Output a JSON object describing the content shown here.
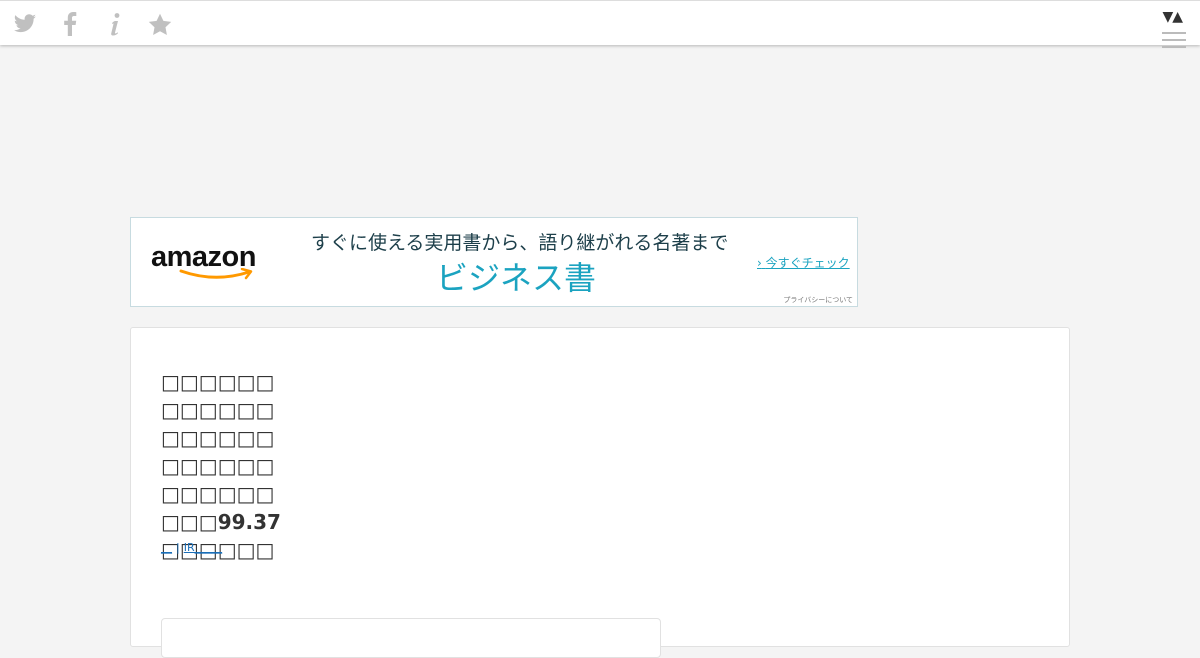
{
  "toolbar": {
    "icons": [
      "twitter-icon",
      "facebook-icon",
      "info-icon",
      "star-icon"
    ],
    "sort_toggle": "▼▲",
    "icon_color": "#c0c0c0"
  },
  "ad": {
    "brand": "amazon",
    "tagline": "すぐに使える実用書から、語り継がれる名著まで",
    "headline": "ビジネス書",
    "cta": "今すぐチェック",
    "privacy": "プライバシーについて",
    "accent_color": "#1ba3c0",
    "smile_color": "#ff9900"
  },
  "article": {
    "title": "□□□□□□□□□□□□□□□□□□□□□□□□□□□□□□□□□99.37□□□□□□",
    "link_primary": "__",
    "link_secondary": "IR_____",
    "link_color": "#1b6fb8"
  }
}
